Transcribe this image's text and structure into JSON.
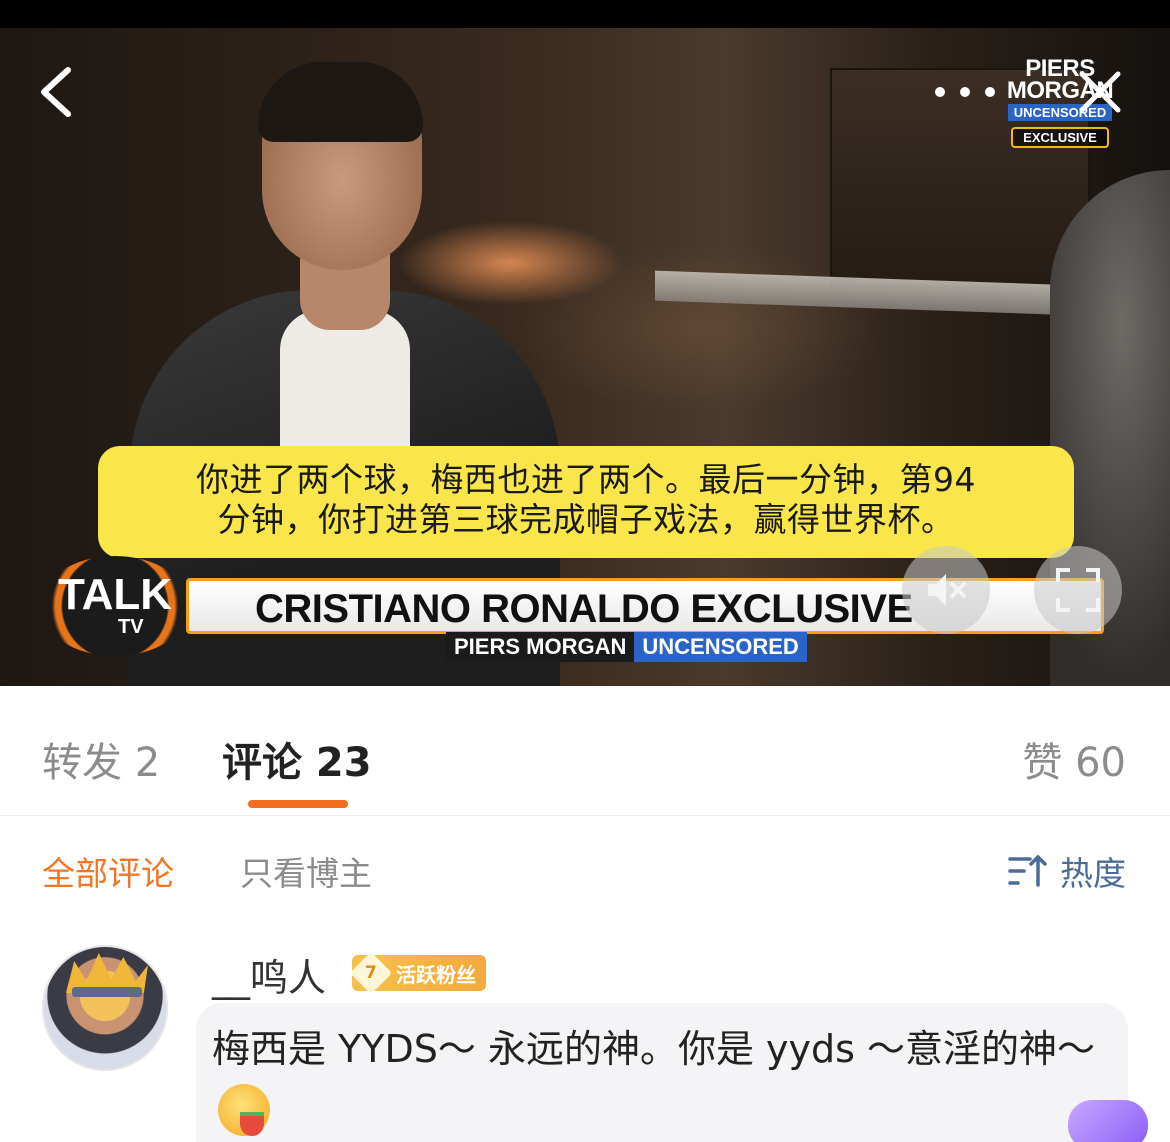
{
  "video": {
    "show_logo": {
      "line1": "PIERS",
      "line2": "MORGAN",
      "line3": "UNCENSORED",
      "line4": "EXCLUSIVE"
    },
    "subtitle_line1": "你进了两个球，梅西也进了两个。最后一分钟，第94",
    "subtitle_line2": "分钟，你打进第三球完成帽子戏法，赢得世界杯。",
    "channel_logo": {
      "main": "TALK",
      "sub": "TV"
    },
    "banner_title": "CRISTIANO RONALDO EXCLUSIVE",
    "banner_sub_a": "PIERS MORGAN",
    "banner_sub_b": "UNCENSORED",
    "icons": {
      "back": "chevron-left-icon",
      "more": "more-dots-icon",
      "close": "close-icon",
      "mute": "mute-icon",
      "fullscreen": "fullscreen-icon"
    }
  },
  "tabs": {
    "repost": "转发 2",
    "comments": "评论 23",
    "likes": "赞 60",
    "active_color": "#f26d1d"
  },
  "filter": {
    "all": "全部评论",
    "author_only": "只看博主",
    "sort": "热度",
    "sort_icon": "sort-icon"
  },
  "comment": {
    "username": "__鸣人",
    "fan_level": "7",
    "fan_label": "活跃粉丝",
    "text": "梅西是 YYDS～ 永远的神。你是 yyds ～意淫的神～",
    "emoji": "smiling-emoji-icon"
  },
  "colors": {
    "accent_orange": "#f07524",
    "sort_blue": "#4b6b99",
    "subtitle_yellow": "#f8e64a"
  }
}
